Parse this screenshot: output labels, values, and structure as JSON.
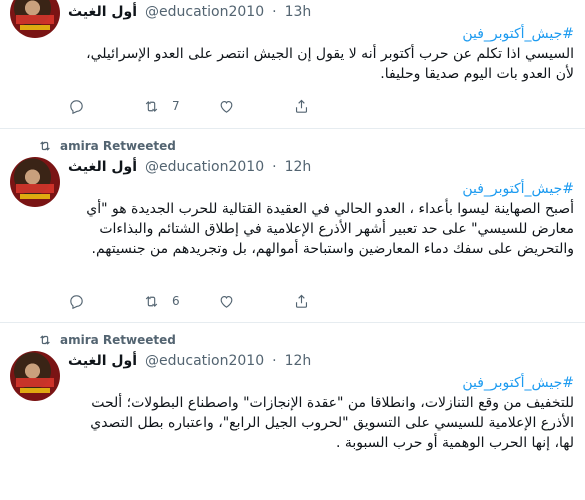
{
  "tweets": [
    {
      "name": "أول الغيث",
      "handle": "@education2010",
      "dot": "·",
      "time": "13h",
      "hashtag": "#جيش_أكتوبر_فين",
      "text": "السيسي اذا تكلم عن حرب أكتوبر أنه لا  يقول إن الجيش انتصر على العدو الإسرائيلي، لأن العدو بات اليوم صديقا وحليفا.",
      "retweets": "7",
      "retweeted_by": ""
    },
    {
      "retweeted_by": "amira Retweeted",
      "name": "أول الغيث",
      "handle": "@education2010",
      "dot": "·",
      "time": "12h",
      "hashtag": "#جيش_أكتوبر_فين",
      "text": "أصبح الصهاينة ليسوا بأعداء ، العدو الحالي في العقيدة القتالية للحرب الجديدة هو \"أي معارض للسيسي\" على حد تعبير أشهر الأذرع الإعلامية في إطلاق الشتائم والبذاءات والتحريض على سفك دماء المعارضين واستباحة أموالهم، بل وتجريدهم من جنسيتهم.",
      "retweets": "6"
    },
    {
      "retweeted_by": "amira Retweeted",
      "name": "أول الغيث",
      "handle": "@education2010",
      "dot": "·",
      "time": "12h",
      "hashtag": "#جيش_أكتوبر_فين",
      "text": "للتخفيف من وقع التنازلات، وانطلاقا من \"عقدة الإنجازات\" واصطناع البطولات؛ ألحت الأذرع الإعلامية للسيسي على التسويق \"لحروب الجيل الرابع\"، واعتباره بطل التصدي لها، إنها الحرب الوهمية أو حرب السبوبة ."
    }
  ]
}
